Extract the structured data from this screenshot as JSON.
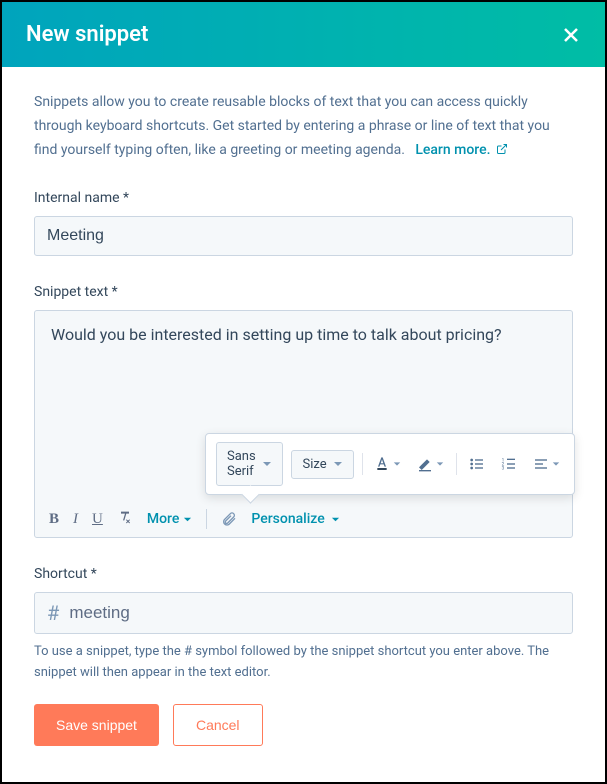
{
  "header": {
    "title": "New snippet"
  },
  "description": {
    "text": "Snippets allow you to create reusable blocks of text that you can access quickly through keyboard shortcuts. Get started by entering a phrase or line of text that you find yourself typing often, like a greeting or meeting agenda.",
    "learn_more": "Learn more."
  },
  "fields": {
    "internal_name": {
      "label": "Internal name *",
      "value": "Meeting"
    },
    "snippet_text": {
      "label": "Snippet text *",
      "value": "Would you be interested in setting up time to talk about pricing?"
    },
    "shortcut": {
      "label": "Shortcut *",
      "prefix": "#",
      "value": "meeting",
      "helper": "To use a snippet, type the # symbol followed by the snippet shortcut you enter above. The snippet will then appear in the text editor."
    }
  },
  "toolbar": {
    "bold": "B",
    "italic": "I",
    "underline": "U",
    "clear": "Tx",
    "more": "More",
    "personalize": "Personalize"
  },
  "popover": {
    "font_family": "Sans Serif",
    "size": "Size"
  },
  "footer": {
    "save": "Save snippet",
    "cancel": "Cancel"
  }
}
